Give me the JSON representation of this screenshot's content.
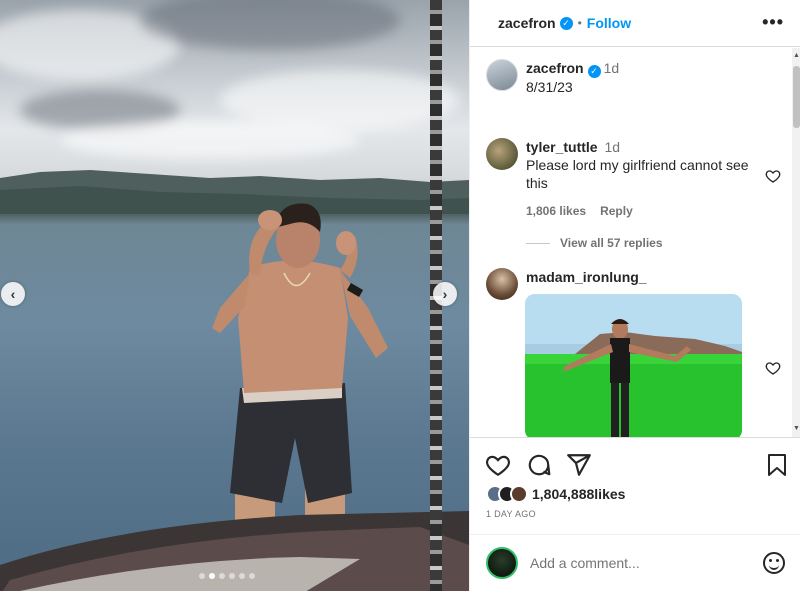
{
  "post": {
    "author": "zacefron",
    "follow_label": "Follow",
    "separator": "•",
    "more_label": "•••",
    "caption_time": "1d",
    "caption_text": "8/31/23",
    "carousel_count": 6,
    "carousel_active_index": 1
  },
  "comments": [
    {
      "username": "tyler_tuttle",
      "time": "1d",
      "text": "Please lord my girlfriend cannot see this",
      "likes": "1,806 likes",
      "reply_label": "Reply",
      "view_replies": "View all 57 replies"
    },
    {
      "username": "madam_ironlung_",
      "has_gif": true
    }
  ],
  "footer": {
    "likes_count": "1,804,888",
    "likes_suffix": " likes",
    "time_ago": "1 DAY AGO",
    "comment_placeholder": "Add a comment..."
  },
  "icons": {
    "prev": "chevron-left-icon",
    "next": "chevron-right-icon",
    "like": "heart-icon",
    "comment": "comment-icon",
    "share": "share-icon",
    "save": "bookmark-icon",
    "emoji": "emoji-icon"
  },
  "colors": {
    "accent": "#0095f6",
    "text": "#262626",
    "muted": "#737373"
  }
}
